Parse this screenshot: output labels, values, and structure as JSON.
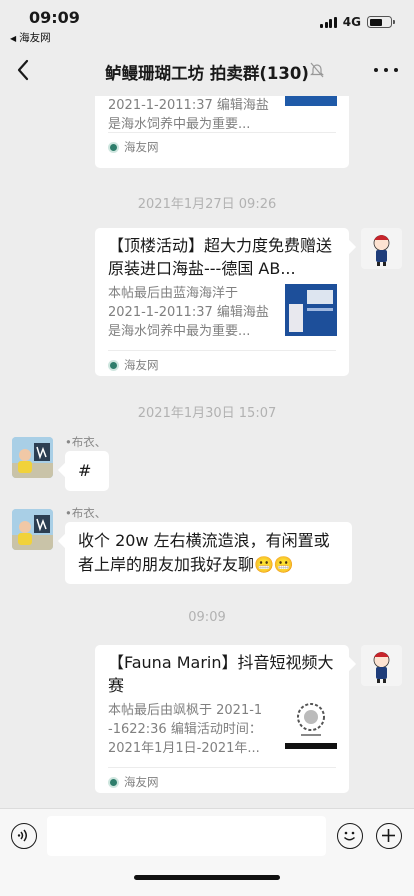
{
  "status_bar": {
    "time": "09:09",
    "back_app": "海友网",
    "network": "4G"
  },
  "nav": {
    "title": "鲈鳗珊瑚工坊 拍卖群(130)"
  },
  "chat": {
    "partial_card": {
      "desc_lines": [
        "2021-1-2011:37 编辑海盐",
        "是海水饲养中最为重要..."
      ],
      "source": "海友网"
    },
    "ts1": "2021年1月27日 09:26",
    "card1": {
      "title": "【顶楼活动】超大力度免费赠送原装进口海盐---德国 AB...",
      "desc_lines": [
        "本帖最后由蓝海海洋于",
        "2021-1-2011:37 编辑海盐",
        "是海水饲养中最为重要..."
      ],
      "source": "海友网"
    },
    "ts2": "2021年1月30日 15:07",
    "msg1": {
      "sender": "•布衣、",
      "text": "#"
    },
    "msg2": {
      "sender": "•布衣、",
      "text": "收个 20w 左右横流造浪，有闲置或者上岸的朋友加我好友聊😬😬"
    },
    "ts3": "09:09",
    "card2": {
      "title": "【Fauna Marin】抖音短视频大赛",
      "desc_lines": [
        "本帖最后由飒枫于 2021-1",
        "-1622:36 编辑活动时间：",
        "2021年1月1日-2021年..."
      ],
      "source": "海友网"
    }
  },
  "colors": {
    "background": "#ededed",
    "bubble": "#ffffff",
    "timestamp": "#b2b2b2"
  },
  "icons": [
    "back-icon",
    "mute-icon",
    "more-icon",
    "voice-icon",
    "emoji-icon",
    "plus-icon"
  ]
}
